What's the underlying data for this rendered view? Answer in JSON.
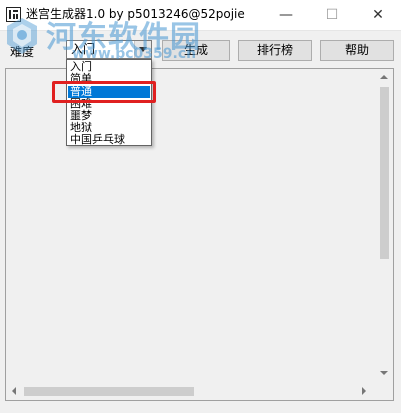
{
  "window": {
    "title": "迷宫生成器1.0 by p5013246@52pojie",
    "minimize_glyph": "—",
    "maximize_glyph": "☐",
    "close_glyph": "✕"
  },
  "watermark": {
    "text": "河东软件园",
    "url": "www.pc0359.cn"
  },
  "toolbar": {
    "difficulty_label": "难度",
    "difficulty_selected": "入门",
    "generate_label": "生成",
    "rank_label": "排行榜",
    "help_label": "帮助"
  },
  "dropdown": {
    "options": [
      "入门",
      "简单",
      "普通",
      "困难",
      "噩梦",
      "地狱",
      "中国乒乓球"
    ],
    "highlighted_index": 2
  },
  "colors": {
    "selection": "#0078d7",
    "annotation_red": "#e02020"
  }
}
